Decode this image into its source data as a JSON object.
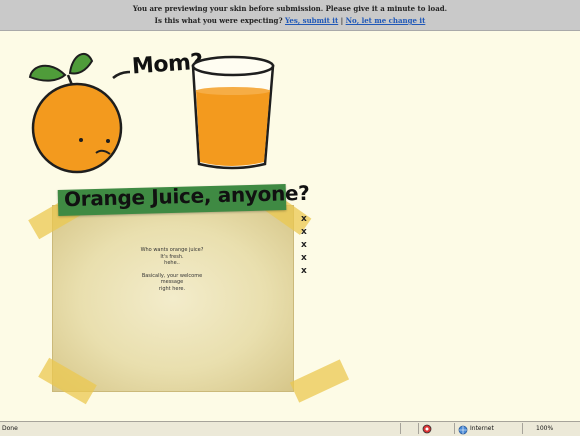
{
  "preview": {
    "message": "You are previewing your skin before submission. Please give it a minute to load.",
    "question": "Is this what you were expecting?",
    "submit_link": "Yes, submit it",
    "separator": "|",
    "change_link": "No, let me change it"
  },
  "header": {
    "speech": "Mom?",
    "banner_title": "Orange Juice, anyone?"
  },
  "welcome": {
    "line1": "Who wants orange juice?",
    "line2": "It's fresh.",
    "line3": "hehe..",
    "line4": "Basically, your welcome message",
    "line5": "right here."
  },
  "nav_marks": [
    "x",
    "x",
    "x",
    "x",
    "x"
  ],
  "statusbar": {
    "status": "Done",
    "zone": "Internet",
    "zoom": "100%"
  },
  "colors": {
    "background": "#fdfbe6",
    "banner_green": "#3f8a43",
    "orange": "#f39a1e",
    "link": "#1f58b8"
  }
}
